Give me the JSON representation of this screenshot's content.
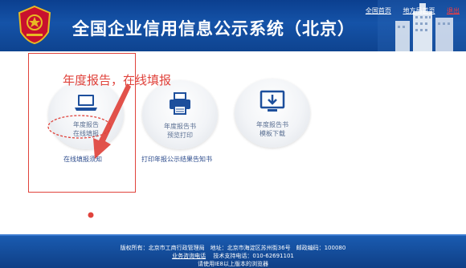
{
  "header": {
    "title": "全国企业信用信息公示系统（北京）",
    "links": {
      "home": "全国首页",
      "local": "地方局首页",
      "exit": "退出"
    }
  },
  "cards": [
    {
      "id": "online",
      "icon": "laptop-icon",
      "label_line1": "年度报告",
      "label_line2": "在线填报"
    },
    {
      "id": "print",
      "icon": "printer-icon",
      "label_line1": "年度报告书",
      "label_line2": "预览打印"
    },
    {
      "id": "download",
      "icon": "monitor-download-icon",
      "label_line1": "年度报告书",
      "label_line2": "模板下载"
    }
  ],
  "links": {
    "fill_notice": "在线填报须知",
    "print_notice": "打印年报公示结果告知书"
  },
  "annotation": {
    "text": "年度报告，在线填报",
    "color": "#e0433c"
  },
  "footer": {
    "line1": "版权所有：北京市工商行政管理局　地址：北京市海淀区苏州街36号　邮政编码：100080",
    "consult": "业务咨询电话",
    "support": "技术支持电话：010-62691101",
    "browser": "请使用IE8以上版本的浏览器"
  },
  "colors": {
    "header": "#1553a8",
    "footer": "#0f3f86",
    "accent_red": "#e0433c",
    "link": "#2f4e8e"
  }
}
